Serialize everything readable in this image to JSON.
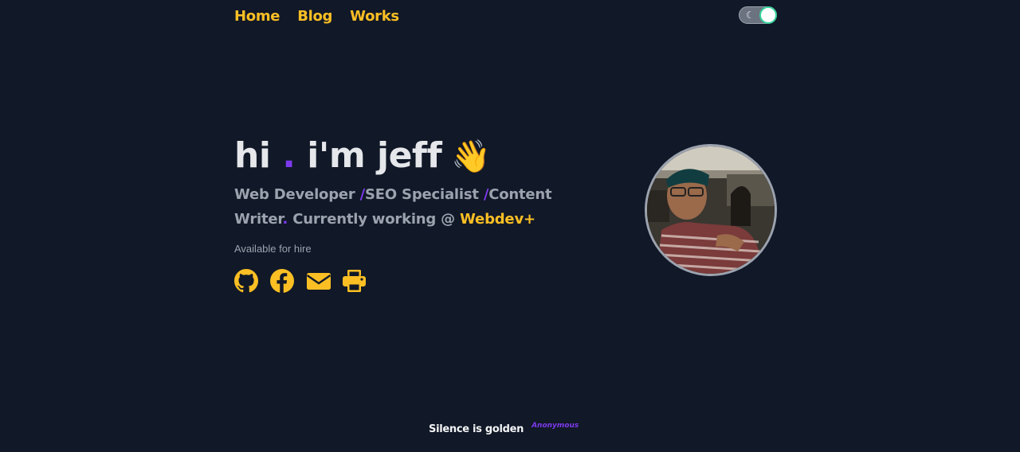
{
  "nav": {
    "items": [
      "Home",
      "Blog",
      "Works"
    ]
  },
  "theme_toggle": {
    "moon_glyph": "☾",
    "state": "dark"
  },
  "hero": {
    "greeting_hi": "hi",
    "greeting_dot": ".",
    "greeting_name": "i'm jeff",
    "wave_emoji": "👋",
    "role_1": "Web Developer",
    "sep": "/",
    "role_2": "SEO Specialist",
    "role_3": "Content Writer",
    "dot": ".",
    "working_text": " Currently working @ ",
    "company": "Webdev+",
    "availability": "Available for hire"
  },
  "socials": {
    "icons": [
      "github-icon",
      "facebook-icon",
      "envelope-icon",
      "print-icon"
    ],
    "color": "#fbbf24"
  },
  "footer": {
    "quote": "Silence is golden",
    "author": "Anonymous"
  },
  "colors": {
    "background": "#111827",
    "accent_yellow": "#fbbf24",
    "accent_purple": "#7c3aed",
    "text_light": "#e5e7eb",
    "text_muted": "#9ca3af"
  }
}
